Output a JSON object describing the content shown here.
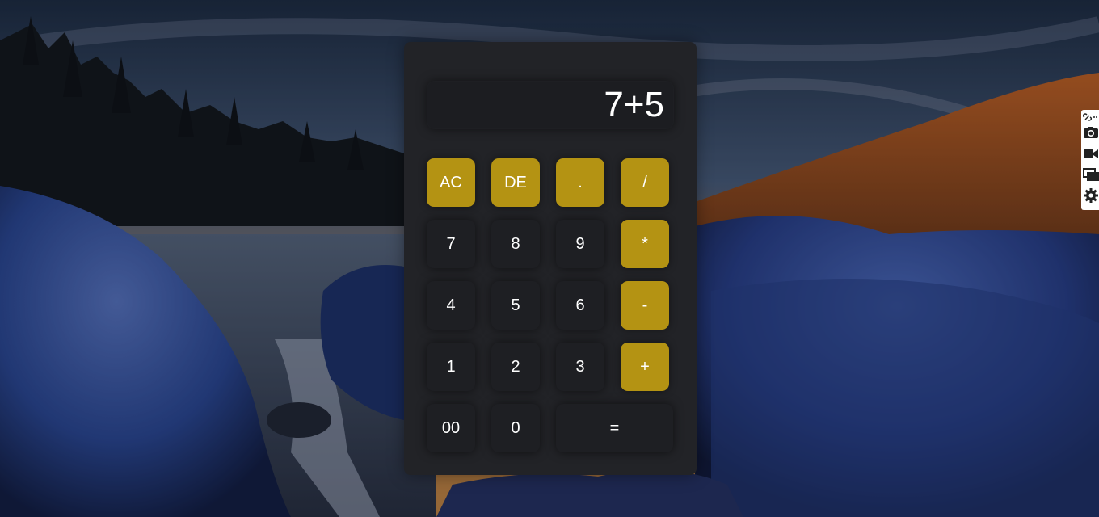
{
  "calculator": {
    "display": "7+5",
    "keys": {
      "ac": "AC",
      "de": "DE",
      "dot": ".",
      "divide": "/",
      "seven": "7",
      "eight": "8",
      "nine": "9",
      "multiply": "*",
      "four": "4",
      "five": "5",
      "six": "6",
      "minus": "-",
      "one": "1",
      "two": "2",
      "three": "3",
      "plus": "+",
      "double_zero": "00",
      "zero": "0",
      "equals": "="
    }
  },
  "colors": {
    "accent": "#b49313",
    "panel": "#222327",
    "key": "#1e1f23"
  },
  "side_toolbar": {
    "icons": [
      "link-icon",
      "camera-icon",
      "video-icon",
      "screens-icon",
      "gear-icon"
    ]
  }
}
